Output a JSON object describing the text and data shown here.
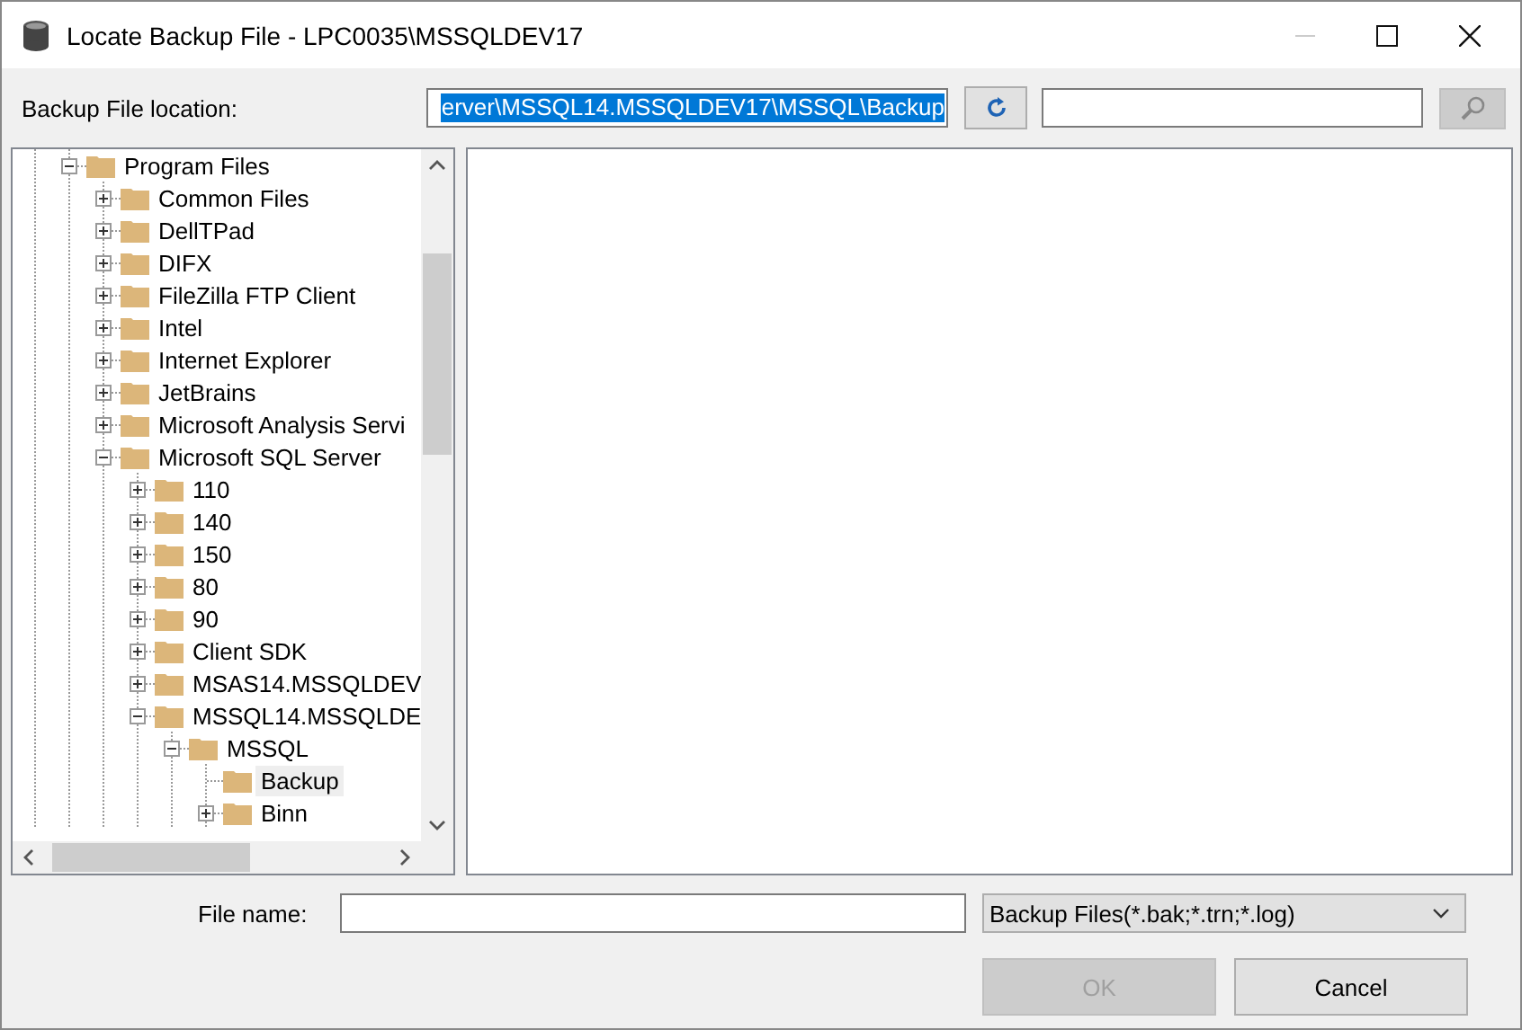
{
  "window": {
    "title": "Locate Backup File - LPC0035\\MSSQLDEV17"
  },
  "location": {
    "label": "Backup File location:",
    "value": "erver\\MSSQL14.MSSQLDEV17\\MSSQL\\Backup"
  },
  "tree": [
    {
      "label": "Program Files",
      "expanded": true,
      "selected": false,
      "children": [
        {
          "label": "Common Files",
          "expanded": false,
          "selected": false
        },
        {
          "label": "DellTPad",
          "expanded": false,
          "selected": false
        },
        {
          "label": "DIFX",
          "expanded": false,
          "selected": false
        },
        {
          "label": "FileZilla FTP Client",
          "expanded": false,
          "selected": false
        },
        {
          "label": "Intel",
          "expanded": false,
          "selected": false
        },
        {
          "label": "Internet Explorer",
          "expanded": false,
          "selected": false
        },
        {
          "label": "JetBrains",
          "expanded": false,
          "selected": false
        },
        {
          "label": "Microsoft Analysis Servi",
          "expanded": false,
          "selected": false
        },
        {
          "label": "Microsoft SQL Server",
          "expanded": true,
          "selected": false,
          "children": [
            {
              "label": "110",
              "expanded": false,
              "selected": false
            },
            {
              "label": "140",
              "expanded": false,
              "selected": false
            },
            {
              "label": "150",
              "expanded": false,
              "selected": false
            },
            {
              "label": "80",
              "expanded": false,
              "selected": false
            },
            {
              "label": "90",
              "expanded": false,
              "selected": false
            },
            {
              "label": "Client SDK",
              "expanded": false,
              "selected": false
            },
            {
              "label": "MSAS14.MSSQLDEV",
              "expanded": false,
              "selected": false
            },
            {
              "label": "MSSQL14.MSSQLDE",
              "expanded": true,
              "selected": false,
              "children": [
                {
                  "label": "MSSQL",
                  "expanded": true,
                  "selected": false,
                  "children": [
                    {
                      "label": "Backup",
                      "selected": true
                    },
                    {
                      "label": "Binn",
                      "expanded": false,
                      "selected": false
                    }
                  ]
                }
              ]
            }
          ]
        }
      ]
    }
  ],
  "file_name": {
    "label": "File name:"
  },
  "file_type": {
    "value": "Backup Files(*.bak;*.trn;*.log)"
  },
  "buttons": [
    {
      "label": "OK",
      "disabled": true
    },
    {
      "label": "Cancel",
      "disabled": false
    }
  ]
}
